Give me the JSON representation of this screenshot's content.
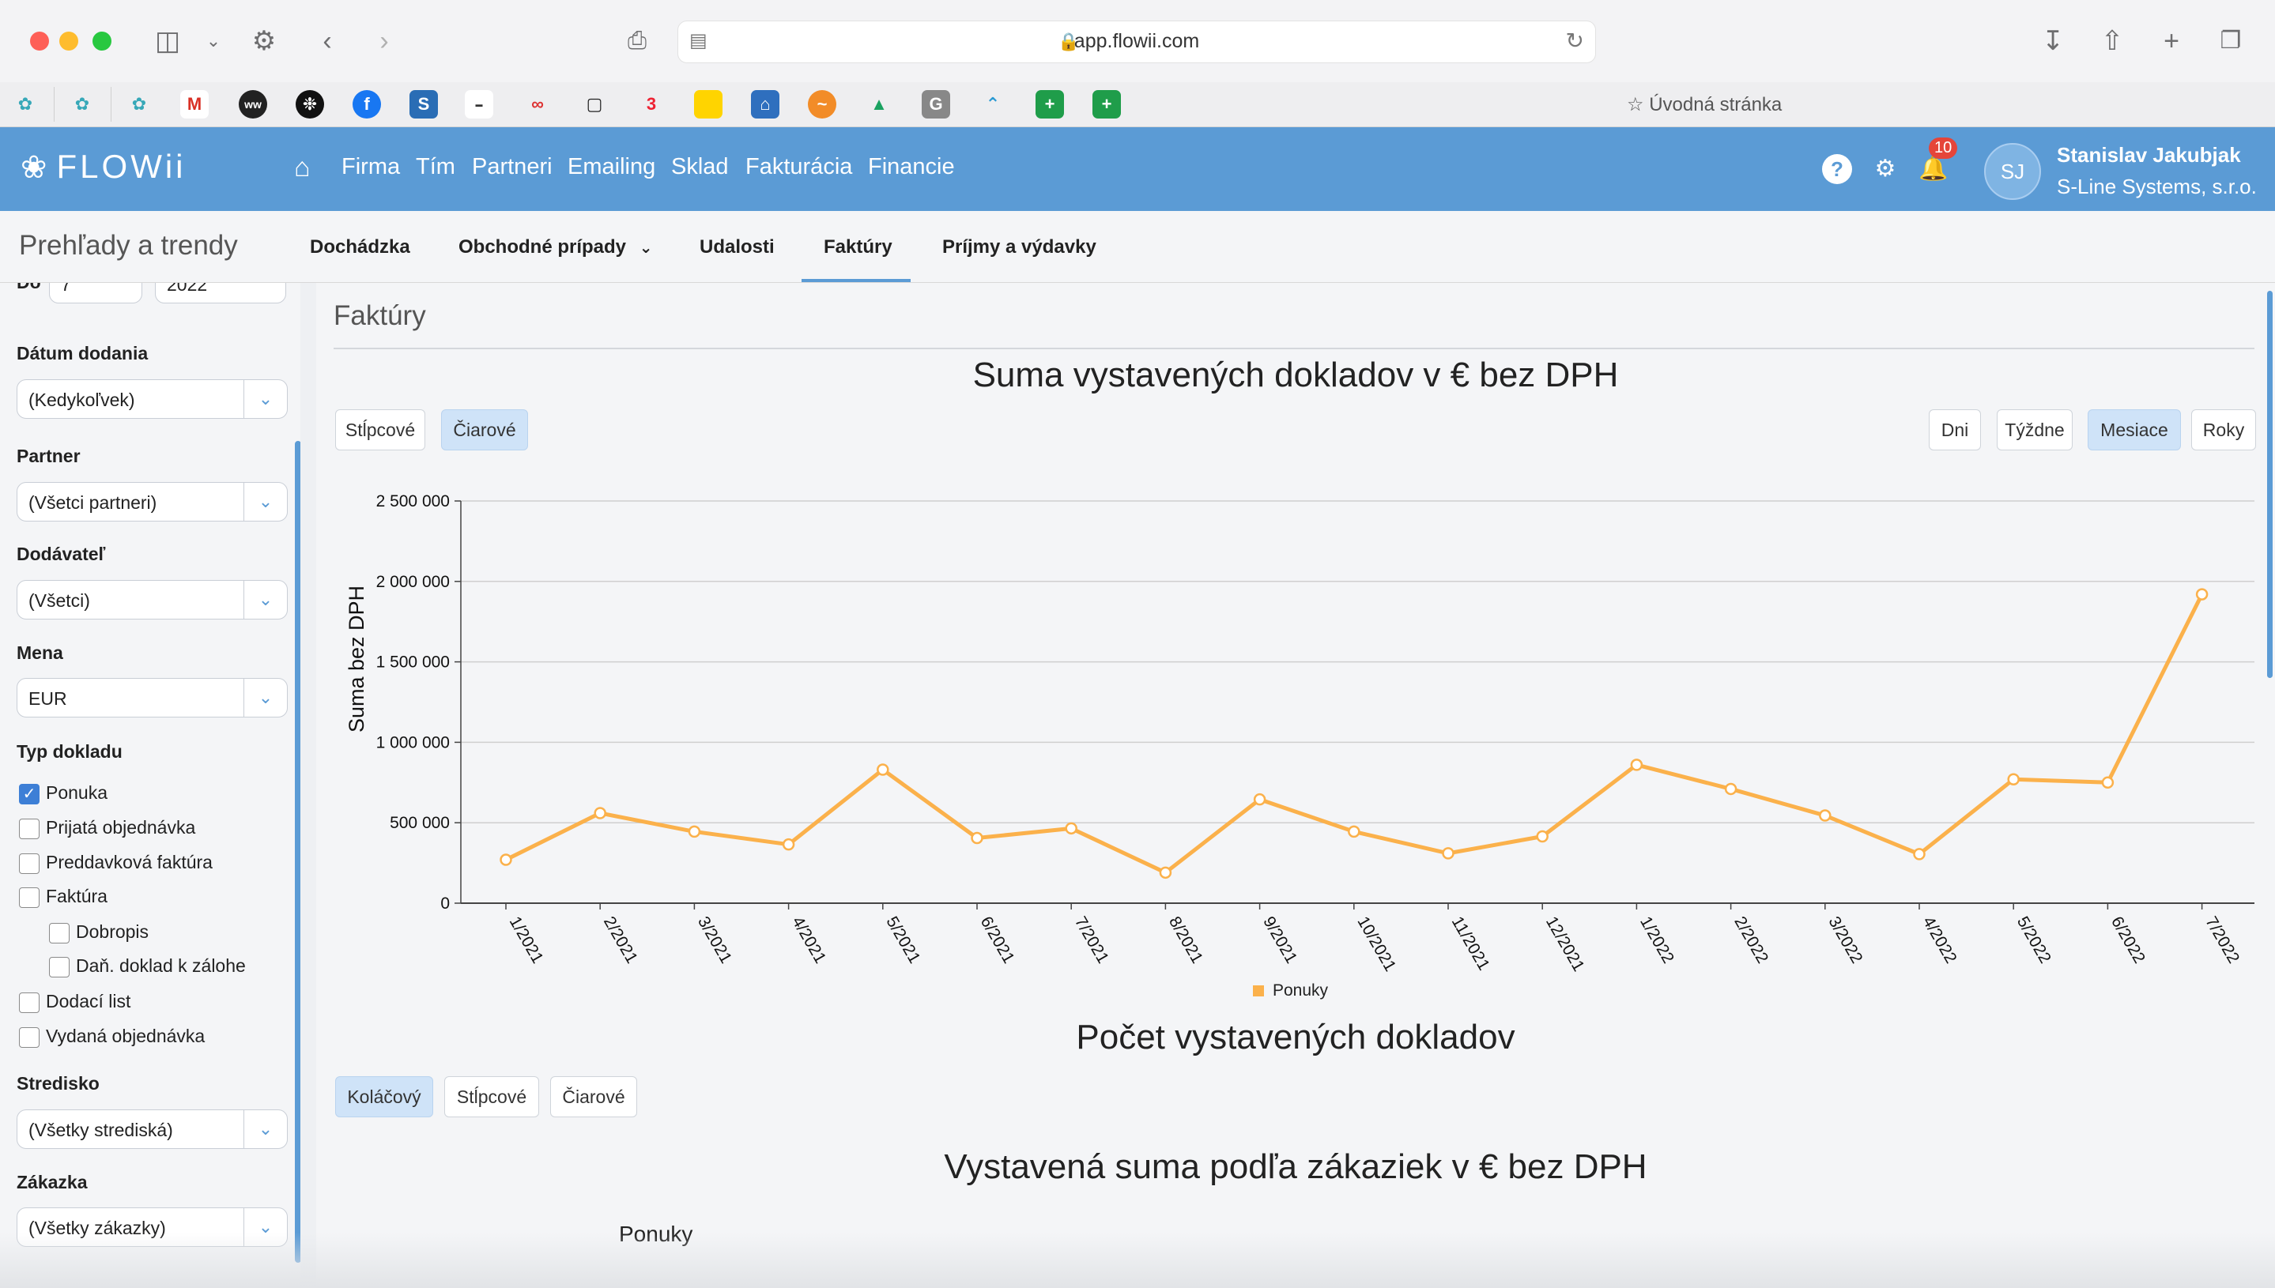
{
  "browser": {
    "url": "app.flowii.com",
    "bookmarks_start_page": "Úvodná stránka"
  },
  "header": {
    "logo": "FLOWii",
    "nav": [
      "Firma",
      "Tím",
      "Partneri",
      "Emailing",
      "Sklad",
      "Fakturácia",
      "Financie"
    ],
    "notifications_count": "10",
    "avatar_initials": "SJ",
    "user_name": "Stanislav Jakubjak",
    "company": "S-Line Systems, s.r.o."
  },
  "subnav": {
    "title": "Prehľady a trendy",
    "tabs": [
      "Dochádzka",
      "Obchodné prípady",
      "Udalosti",
      "Faktúry",
      "Príjmy a výdavky"
    ],
    "active_tab": "Faktúry"
  },
  "sidebar": {
    "partial_top": {
      "label": "Do",
      "month": "7",
      "year": "2022"
    },
    "delivery_date": {
      "label": "Dátum dodania",
      "value": "(Kedykoľvek)"
    },
    "partner": {
      "label": "Partner",
      "value": "(Všetci partneri)"
    },
    "supplier": {
      "label": "Dodávateľ",
      "value": "(Všetci)"
    },
    "currency": {
      "label": "Mena",
      "value": "EUR"
    },
    "doc_type": {
      "label": "Typ dokladu",
      "items": [
        {
          "label": "Ponuka",
          "checked": true
        },
        {
          "label": "Prijatá objednávka",
          "checked": false
        },
        {
          "label": "Preddavková faktúra",
          "checked": false
        },
        {
          "label": "Faktúra",
          "checked": false
        },
        {
          "label": "Dobropis",
          "checked": false
        },
        {
          "label": "Daň. doklad k zálohe",
          "checked": false
        },
        {
          "label": "Dodací list",
          "checked": false
        },
        {
          "label": "Vydaná objednávka",
          "checked": false
        }
      ]
    },
    "center": {
      "label": "Stredisko",
      "value": "(Všetky strediská)"
    },
    "order": {
      "label": "Zákazka",
      "value": "(Všetky zákazky)"
    }
  },
  "main": {
    "section_title": "Faktúry",
    "chart1_title": "Suma vystavených dokladov v € bez DPH",
    "chart1_type_buttons": [
      "Stĺpcové",
      "Čiarové"
    ],
    "chart1_type_active": "Čiarové",
    "period_buttons": [
      "Dni",
      "Týždne",
      "Mesiace",
      "Roky"
    ],
    "period_active": "Mesiace",
    "chart2_title": "Počet vystavených dokladov",
    "chart2_buttons": [
      "Koláčový",
      "Stĺpcové",
      "Čiarové"
    ],
    "chart2_active": "Koláčový",
    "chart3_title": "Vystavená suma podľa zákaziek v € bez DPH",
    "chart3_series_label": "Ponuky"
  },
  "chart_data": {
    "type": "line",
    "ylabel": "Suma bez DPH",
    "xlabel": "",
    "ylim": [
      0,
      2500000
    ],
    "yticks": [
      0,
      500000,
      1000000,
      1500000,
      2000000,
      2500000
    ],
    "ytick_labels": [
      "0",
      "500 000",
      "1 000 000",
      "1 500 000",
      "2 000 000",
      "2 500 000"
    ],
    "categories": [
      "1/2021",
      "2/2021",
      "3/2021",
      "4/2021",
      "5/2021",
      "6/2021",
      "7/2021",
      "8/2021",
      "9/2021",
      "10/2021",
      "11/2021",
      "12/2021",
      "1/2022",
      "2/2022",
      "3/2022",
      "4/2022",
      "5/2022",
      "6/2022",
      "7/2022"
    ],
    "series": [
      {
        "name": "Ponuky",
        "color": "#fbb14b",
        "values": [
          270000,
          560000,
          445000,
          365000,
          830000,
          405000,
          465000,
          190000,
          645000,
          445000,
          310000,
          415000,
          860000,
          710000,
          545000,
          305000,
          770000,
          750000,
          1920000
        ]
      }
    ],
    "legend": "bottom-center",
    "grid": true
  }
}
